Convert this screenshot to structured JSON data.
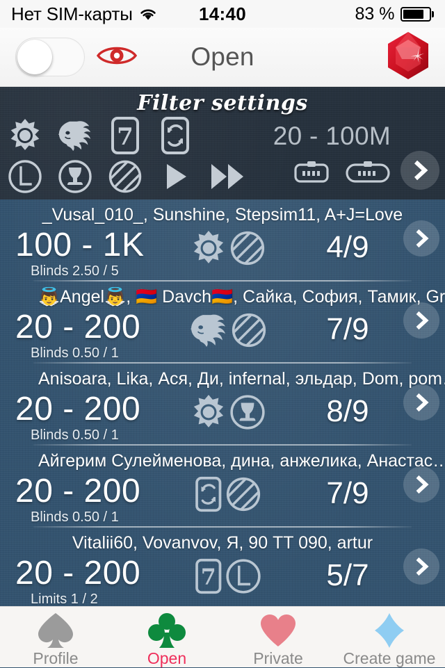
{
  "statusbar": {
    "carrier": "Нет SIM-карты",
    "wifi_icon": "wifi-icon",
    "time": "14:40",
    "battery_percent": "83 %",
    "battery_level": 83
  },
  "navbar": {
    "toggle_name": "visibility-toggle",
    "toggle_on": false,
    "eye_icon": "eye-icon",
    "eye_color": "#cf2a2a",
    "title": "Open",
    "gem_icon": "ruby-gem-icon",
    "gem_color": "#d6172a"
  },
  "filter": {
    "title": "Filter settings",
    "stake_range": "20 - 100M",
    "chevron_icon": "chevron-right-icon",
    "row1_icons": [
      "sheriff-star-icon",
      "indian-chief-icon",
      "card-seven-icon",
      "card-swap-icon"
    ],
    "row2_icons": [
      "circle-l-icon",
      "trophy-circle-icon",
      "striped-circle-icon",
      "play-icon",
      "fast-forward-icon"
    ],
    "table_icons": [
      "short-table-icon",
      "long-table-icon"
    ],
    "background_color": "#26313d"
  },
  "list": {
    "background_color": "#33536f",
    "rows": [
      {
        "players": "_Vusal_010_, Sunshine, Stepsim11, A+J=Love",
        "stakes": "100 - 1K",
        "sublabel": "Blinds 2.50 / 5",
        "icons": [
          "sheriff-star-icon",
          "striped-circle-icon"
        ],
        "seats": "4/9"
      },
      {
        "players": "👼Angel👼, 🇦🇲 Davch🇦🇲, Сайка, София, Тамик, Gr…",
        "stakes": "20 - 200",
        "sublabel": "Blinds 0.50 / 1",
        "icons": [
          "indian-chief-icon",
          "striped-circle-icon"
        ],
        "seats": "7/9"
      },
      {
        "players": "Anisoara, Lika, Ася, Ди, infernal, эльдар, Dom, pom…",
        "stakes": "20 - 200",
        "sublabel": "Blinds 0.50 / 1",
        "icons": [
          "sheriff-star-icon",
          "trophy-circle-icon"
        ],
        "seats": "8/9"
      },
      {
        "players": "Айгерим Сулейменова, дина, анжелика, Анастас…",
        "stakes": "20 - 200",
        "sublabel": "Blinds 0.50 / 1",
        "icons": [
          "card-swap-icon",
          "striped-circle-icon"
        ],
        "seats": "7/9"
      },
      {
        "players": "Vitalii60, Vovanvov, Я, 90 TT 090, artur",
        "stakes": "20 - 200",
        "sublabel": "Limits 1 / 2",
        "icons": [
          "card-seven-icon",
          "circle-l-icon"
        ],
        "seats": "5/7"
      }
    ]
  },
  "tabbar": {
    "active_color": "#ef2f5b",
    "items": [
      {
        "label": "Profile",
        "icon": "spade-icon",
        "color": "#9b9b9b",
        "active": false
      },
      {
        "label": "Open",
        "icon": "club-icon",
        "color": "#0e8a3e",
        "active": true
      },
      {
        "label": "Private",
        "icon": "heart-icon",
        "color": "#e8808a",
        "active": false
      },
      {
        "label": "Create game",
        "icon": "diamond-icon",
        "color": "#8fcdf2",
        "active": false
      }
    ]
  }
}
